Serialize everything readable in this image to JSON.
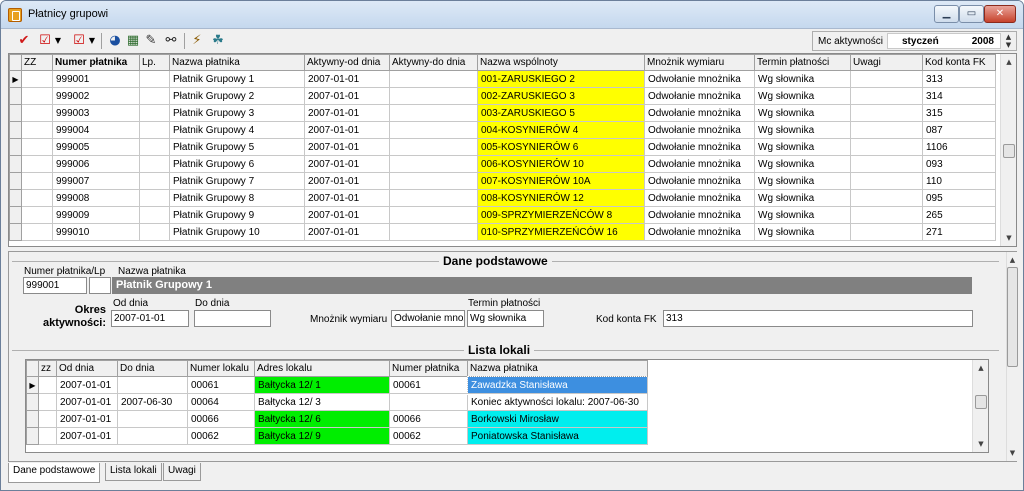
{
  "window": {
    "title": "Płatnicy grupowi"
  },
  "toolbar": {
    "icons": [
      "check-red-icon",
      "check-box-icon",
      "dropdown-icon",
      "check-box-icon",
      "dropdown-icon",
      "color-circle-icon",
      "grid-color-icon",
      "edit-form-icon",
      "binoculars-icon",
      "wand-icon",
      "people-icon"
    ]
  },
  "mc": {
    "label": "Mc aktywności",
    "month": "styczeń",
    "year": "2008"
  },
  "grid": {
    "headers": [
      "ZZ",
      "Numer płatnika",
      "Lp.",
      "Nazwa płatnika",
      "Aktywny-od dnia",
      "Aktywny-do dnia",
      "Nazwa wspólnoty",
      "Mnożnik wymiaru",
      "Termin płatności",
      "Uwagi",
      "Kod konta FK"
    ],
    "rows": [
      [
        "",
        "999001",
        "",
        "Płatnik Grupowy 1",
        "2007-01-01",
        "",
        "001-ZARUSKIEGO 2",
        "Odwołanie mnożnika",
        "Wg słownika",
        "",
        "313"
      ],
      [
        "",
        "999002",
        "",
        "Płatnik Grupowy 2",
        "2007-01-01",
        "",
        "002-ZARUSKIEGO 3",
        "Odwołanie mnożnika",
        "Wg słownika",
        "",
        "314"
      ],
      [
        "",
        "999003",
        "",
        "Płatnik Grupowy 3",
        "2007-01-01",
        "",
        "003-ZARUSKIEGO 5",
        "Odwołanie mnożnika",
        "Wg słownika",
        "",
        "315"
      ],
      [
        "",
        "999004",
        "",
        "Płatnik Grupowy 4",
        "2007-01-01",
        "",
        "004-KOSYNIERÓW 4",
        "Odwołanie mnożnika",
        "Wg słownika",
        "",
        "087"
      ],
      [
        "",
        "999005",
        "",
        "Płatnik Grupowy 5",
        "2007-01-01",
        "",
        "005-KOSYNIERÓW 6",
        "Odwołanie mnożnika",
        "Wg słownika",
        "",
        "1106"
      ],
      [
        "",
        "999006",
        "",
        "Płatnik Grupowy 6",
        "2007-01-01",
        "",
        "006-KOSYNIERÓW 10",
        "Odwołanie mnożnika",
        "Wg słownika",
        "",
        "093"
      ],
      [
        "",
        "999007",
        "",
        "Płatnik Grupowy 7",
        "2007-01-01",
        "",
        "007-KOSYNIERÓW 10A",
        "Odwołanie mnożnika",
        "Wg słownika",
        "",
        "110"
      ],
      [
        "",
        "999008",
        "",
        "Płatnik Grupowy 8",
        "2007-01-01",
        "",
        "008-KOSYNIERÓW 12",
        "Odwołanie mnożnika",
        "Wg słownika",
        "",
        "095"
      ],
      [
        "",
        "999009",
        "",
        "Płatnik Grupowy 9",
        "2007-01-01",
        "",
        "009-SPRZYMIERZEŃCÓW 8",
        "Odwołanie mnożnika",
        "Wg słownika",
        "",
        "265"
      ],
      [
        "",
        "999010",
        "",
        "Płatnik Grupowy 10",
        "2007-01-01",
        "",
        "010-SPRZYMIERZEŃCÓW 16",
        "Odwołanie mnożnika",
        "Wg słownika",
        "",
        "271"
      ]
    ]
  },
  "details": {
    "section_title": "Dane podstawowe",
    "numer_label": "Numer płatnika/Lp",
    "nazwa_label": "Nazwa płatnika",
    "numer_value": "999001",
    "lp_value": "",
    "nazwa_value": "Płatnik Grupowy 1",
    "okres_label": "Okres aktywności:",
    "od_label": "Od dnia",
    "do_label": "Do dnia",
    "od_value": "2007-01-01",
    "do_value": "",
    "mnoznik_label": "Mnożnik wymiaru",
    "mnoznik_value": "Odwołanie mnożnika",
    "termin_label": "Termin płatności",
    "termin_value": "Wg słownika",
    "kod_label": "Kod konta FK",
    "kod_value": "313"
  },
  "lokale": {
    "section_title": "Lista lokali",
    "headers": [
      "zz",
      "Od dnia",
      "Do dnia",
      "Numer lokalu",
      "Adres lokalu",
      "Numer płatnika",
      "Nazwa płatnika"
    ],
    "rows": [
      {
        "cells": [
          "",
          "2007-01-01",
          "",
          "00061",
          "Bałtycka 12/ 1",
          "00061",
          "Zawadzka Stanisława"
        ],
        "addr_color": "#00ee00",
        "name_style": "selected"
      },
      {
        "cells": [
          "",
          "2007-01-01",
          "2007-06-30",
          "00064",
          "Bałtycka 12/ 3",
          "",
          "Koniec aktywności lokalu: 2007-06-30"
        ],
        "addr_color": "",
        "name_style": "plain"
      },
      {
        "cells": [
          "",
          "2007-01-01",
          "",
          "00066",
          "Bałtycka 12/ 6",
          "00066",
          "Borkowski Mirosław"
        ],
        "addr_color": "#00ee00",
        "name_style": "cyan"
      },
      {
        "cells": [
          "",
          "2007-01-01",
          "",
          "00062",
          "Bałtycka 12/ 9",
          "00062",
          "Poniatowska Stanisława"
        ],
        "addr_color": "#00ee00",
        "name_style": "cyan"
      }
    ]
  },
  "tabs": [
    "Dane podstawowe",
    "Lista lokali",
    "Uwagi"
  ]
}
